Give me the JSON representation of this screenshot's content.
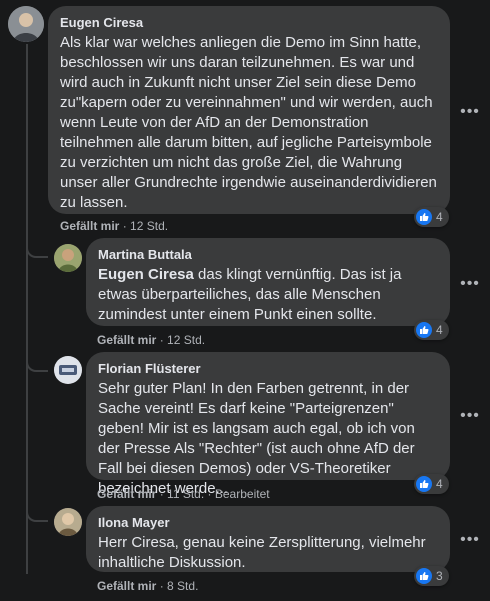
{
  "comments": [
    {
      "author": "Eugen Ciresa",
      "text": "Als klar war welches anliegen die Demo im Sinn hatte, beschlossen wir uns daran teilzunehmen. Es war und wird auch in Zukunft nicht unser Ziel sein diese Demo zu\"kapern oder zu vereinnahmen\" und wir werden, auch wenn Leute von der AfD an der Demonstration teilnehmen alle darum bitten, auf jegliche Parteisymbole zu verzichten um nicht das große Ziel, die Wahrung unser aller Grundrechte irgendwie auseinanderdividieren zu lassen.",
      "like_label": "Gefällt mir",
      "time": "12 Std.",
      "reactions": "4"
    }
  ],
  "replies": [
    {
      "author": "Martina Buttala",
      "mention": "Eugen Ciresa",
      "text": " das klingt vernünftig. Das ist ja etwas überparteiliches, das alle Menschen zumindest unter einem Punkt einen sollte.",
      "like_label": "Gefällt mir",
      "time": "12 Std.",
      "reactions": "4"
    },
    {
      "author": "Florian Flüsterer",
      "text": "Sehr guter Plan! In den Farben getrennt, in der Sache vereint! Es darf keine \"Parteigrenzen\" geben! Mir ist es langsam auch egal, ob ich von der Presse Als \"Rechter\" (ist auch ohne AfD der Fall bei diesen Demos) oder VS-Theoretiker bezeichnet werde...",
      "like_label": "Gefällt mir",
      "time": "11 Std.",
      "edited": "Bearbeitet",
      "reactions": "4"
    },
    {
      "author": "Ilona Mayer",
      "text": "Herr Ciresa, genau keine Zersplitterung, vielmehr inhaltliche Diskussion.",
      "like_label": "Gefällt mir",
      "time": "8 Std.",
      "reactions": "3"
    }
  ],
  "colors": {
    "background": "#18191a",
    "bubble": "#3a3b3c",
    "text": "#e4e6eb",
    "secondary": "#b0b3b8",
    "like_blue": "#1877f2"
  },
  "icons": {
    "more": "more-options-icon",
    "reaction": "thumbs-up-icon"
  }
}
